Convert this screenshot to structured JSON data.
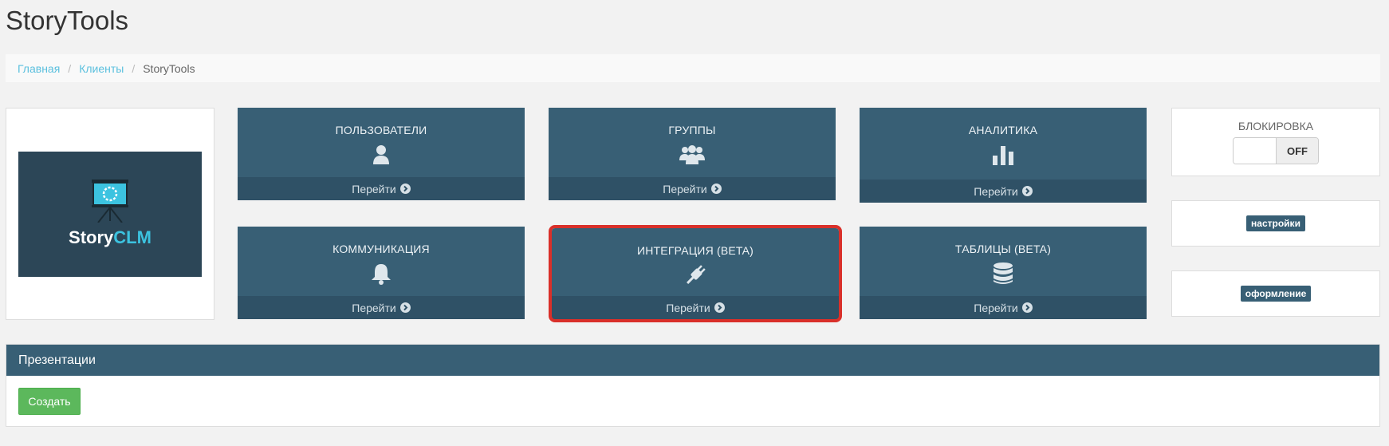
{
  "header": {
    "title": "StoryTools"
  },
  "breadcrumb": {
    "home": "Главная",
    "clients": "Клиенты",
    "current": "StoryTools",
    "separator": "/"
  },
  "logo": {
    "text_main": "Story",
    "text_accent": "CLM"
  },
  "tiles": [
    {
      "title": "ПОЛЬЗОВАТЕЛИ",
      "icon": "user-icon",
      "link": "Перейти"
    },
    {
      "title": "ГРУППЫ",
      "icon": "group-icon",
      "link": "Перейти"
    },
    {
      "title": "АНАЛИТИКА",
      "icon": "bar-chart-icon",
      "link": "Перейти"
    },
    {
      "title": "КОММУНИКАЦИЯ",
      "icon": "bell-icon",
      "link": "Перейти"
    },
    {
      "title": "ИНТЕГРАЦИЯ (BETA)",
      "icon": "plug-icon",
      "link": "Перейти"
    },
    {
      "title": "ТАБЛИЦЫ (BETA)",
      "icon": "database-icon",
      "link": "Перейти"
    }
  ],
  "sidebar": {
    "blocking_label": "БЛОКИРОВКА",
    "blocking_state": "OFF",
    "settings_label": "настройки",
    "design_label": "оформление"
  },
  "presentations": {
    "heading": "Презентации",
    "create_label": "Создать"
  },
  "colors": {
    "tile_bg": "#385f75",
    "tile_footer": "#2f5166",
    "highlight": "#d9302a",
    "link": "#5bc0de",
    "create_btn": "#5cb85c"
  }
}
